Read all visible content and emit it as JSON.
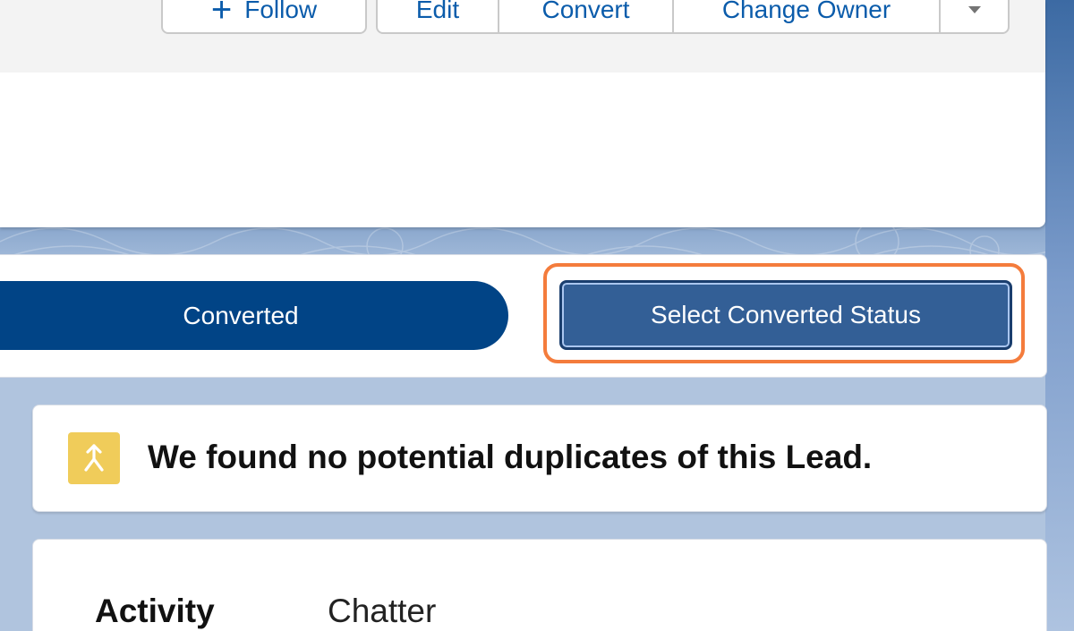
{
  "header": {
    "follow_label": "Follow",
    "edit_label": "Edit",
    "convert_label": "Convert",
    "change_owner_label": "Change Owner"
  },
  "path": {
    "stage_label": "Converted",
    "select_status_label": "Select Converted Status"
  },
  "duplicates": {
    "message": "We found no potential duplicates of this Lead."
  },
  "tabs": {
    "activity_label": "Activity",
    "chatter_label": "Chatter"
  },
  "colors": {
    "stage_blue": "#014486",
    "highlight_orange": "#f47c3c",
    "duplicate_icon_yellow": "#f0cc5a",
    "link_blue": "#0b5cab"
  }
}
